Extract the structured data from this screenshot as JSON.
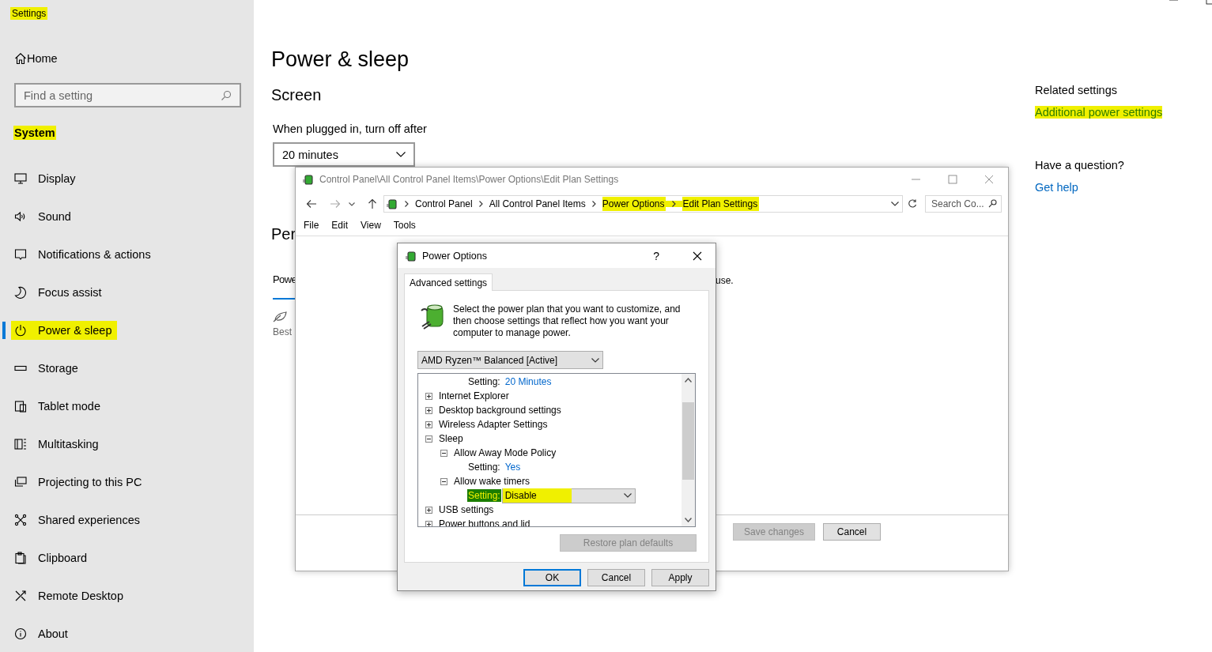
{
  "settings_window": {
    "title": {
      "text": "Settings",
      "highlighted": true
    },
    "home": "Home",
    "search": {
      "placeholder": "Find a setting"
    },
    "section": {
      "text": "System",
      "highlighted": true
    },
    "nav_items": [
      {
        "label": "Display",
        "selected": false,
        "highlighted": false
      },
      {
        "label": "Sound",
        "selected": false,
        "highlighted": false
      },
      {
        "label": "Notifications & actions",
        "selected": false,
        "highlighted": false
      },
      {
        "label": "Focus assist",
        "selected": false,
        "highlighted": false
      },
      {
        "label": "Power & sleep",
        "selected": true,
        "highlighted": true
      },
      {
        "label": "Storage",
        "selected": false,
        "highlighted": false
      },
      {
        "label": "Tablet mode",
        "selected": false,
        "highlighted": false
      },
      {
        "label": "Multitasking",
        "selected": false,
        "highlighted": false
      },
      {
        "label": "Projecting to this PC",
        "selected": false,
        "highlighted": false
      },
      {
        "label": "Shared experiences",
        "selected": false,
        "highlighted": false
      },
      {
        "label": "Clipboard",
        "selected": false,
        "highlighted": false
      },
      {
        "label": "Remote Desktop",
        "selected": false,
        "highlighted": false
      },
      {
        "label": "About",
        "selected": false,
        "highlighted": false
      }
    ],
    "page_title": "Power & sleep",
    "screen_heading": "Screen",
    "plugged_label": "When plugged in, turn off after",
    "plugged_value": "20 minutes",
    "performance_heading": "Per",
    "power_mode_label": "Powe",
    "best_label": "Best",
    "related": {
      "heading": "Related settings",
      "link": {
        "text": "Additional power settings",
        "highlighted": true
      }
    },
    "question": {
      "heading": "Have a question?",
      "link": "Get help"
    }
  },
  "control_panel": {
    "title": "Control Panel\\All Control Panel Items\\Power Options\\Edit Plan Settings",
    "breadcrumb": [
      {
        "label": "Control Panel",
        "highlighted": false
      },
      {
        "label": "All Control Panel Items",
        "highlighted": false
      },
      {
        "label": "Power Options",
        "highlighted": true
      },
      {
        "label": "Edit Plan Settings",
        "highlighted": true
      }
    ],
    "search": {
      "placeholder": "Search Co..."
    },
    "menu": [
      "File",
      "Edit",
      "View",
      "Tools"
    ],
    "body_fragment": "use.",
    "buttons": [
      {
        "label": "Save changes",
        "disabled": true
      },
      {
        "label": "Cancel",
        "disabled": false
      }
    ]
  },
  "power_options": {
    "title": "Power Options",
    "help": "?",
    "tab": {
      "label": "Advanced settings",
      "selected": true
    },
    "intro": "Select the power plan that you want to customize, and then choose settings that reflect how you want your computer to manage power.",
    "plan": "AMD Ryzen™ Balanced [Active]",
    "tree": [
      {
        "kind": "setting",
        "label": "Setting:",
        "value": "20 Minutes"
      },
      {
        "kind": "group",
        "label": "Internet Explorer",
        "expanded": false
      },
      {
        "kind": "group",
        "label": "Desktop background settings",
        "expanded": false
      },
      {
        "kind": "group",
        "label": "Wireless Adapter Settings",
        "expanded": false
      },
      {
        "kind": "group",
        "label": "Sleep",
        "expanded": true,
        "children": [
          {
            "kind": "group",
            "label": "Allow Away Mode Policy",
            "expanded": true,
            "children": [
              {
                "kind": "setting",
                "label": "Setting:",
                "value": "Yes"
              }
            ]
          },
          {
            "kind": "group",
            "label": "Allow wake timers",
            "expanded": true,
            "children": [
              {
                "kind": "dropdown",
                "label": "Setting:",
                "value": "Disable",
                "selected": true,
                "highlighted": true
              }
            ]
          }
        ]
      },
      {
        "kind": "group",
        "label": "USB settings",
        "expanded": false
      },
      {
        "kind": "group",
        "label": "Power buttons and lid",
        "expanded": false
      }
    ],
    "restore_button": {
      "label": "Restore plan defaults",
      "disabled": true
    },
    "buttons": [
      {
        "label": "OK",
        "default": true
      },
      {
        "label": "Cancel",
        "default": false
      },
      {
        "label": "Apply",
        "default": false
      }
    ]
  }
}
